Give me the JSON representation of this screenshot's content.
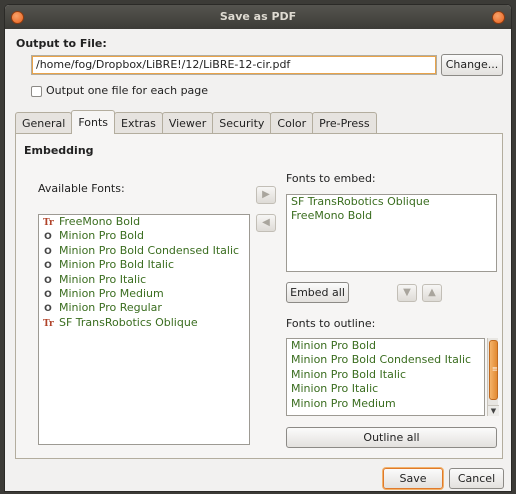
{
  "window": {
    "title": "Save as PDF"
  },
  "output": {
    "label": "Output to File:",
    "path": "/home/fog/Dropbox/LiBRE!/12/LiBRE-12-cir.pdf",
    "change_label": "Change...",
    "one_file_per_page_label": "Output one file for each page",
    "one_file_per_page_checked": false
  },
  "tabs": [
    {
      "label": "General"
    },
    {
      "label": "Fonts",
      "active": true
    },
    {
      "label": "Extras"
    },
    {
      "label": "Viewer"
    },
    {
      "label": "Security"
    },
    {
      "label": "Color"
    },
    {
      "label": "Pre-Press"
    }
  ],
  "embedding": {
    "title": "Embedding",
    "available_fonts_label": "Available Fonts:",
    "available_fonts": [
      {
        "name": "FreeMono Bold",
        "icon": "truetype-icon"
      },
      {
        "name": "Minion Pro Bold",
        "icon": "opentype-icon"
      },
      {
        "name": "Minion Pro Bold Condensed Italic",
        "icon": "opentype-icon"
      },
      {
        "name": "Minion Pro Bold Italic",
        "icon": "opentype-icon"
      },
      {
        "name": "Minion Pro Italic",
        "icon": "opentype-icon"
      },
      {
        "name": "Minion Pro Medium",
        "icon": "opentype-icon"
      },
      {
        "name": "Minion Pro Regular",
        "icon": "opentype-icon"
      },
      {
        "name": "SF TransRobotics Oblique",
        "icon": "truetype-icon"
      }
    ],
    "fonts_to_embed_label": "Fonts to embed:",
    "fonts_to_embed": [
      "SF TransRobotics Oblique",
      "FreeMono Bold"
    ],
    "embed_all_label": "Embed all",
    "fonts_to_outline_label": "Fonts to outline:",
    "fonts_to_outline": [
      "Minion Pro Bold",
      "Minion Pro Bold Condensed Italic",
      "Minion Pro Bold Italic",
      "Minion Pro Italic",
      "Minion Pro Medium"
    ],
    "outline_all_label": "Outline all"
  },
  "buttons": {
    "save": "Save",
    "cancel": "Cancel"
  },
  "colors": {
    "accent": "#e07a2a",
    "font_text": "#3a6d1f",
    "titlebar": "#3c3b37"
  }
}
